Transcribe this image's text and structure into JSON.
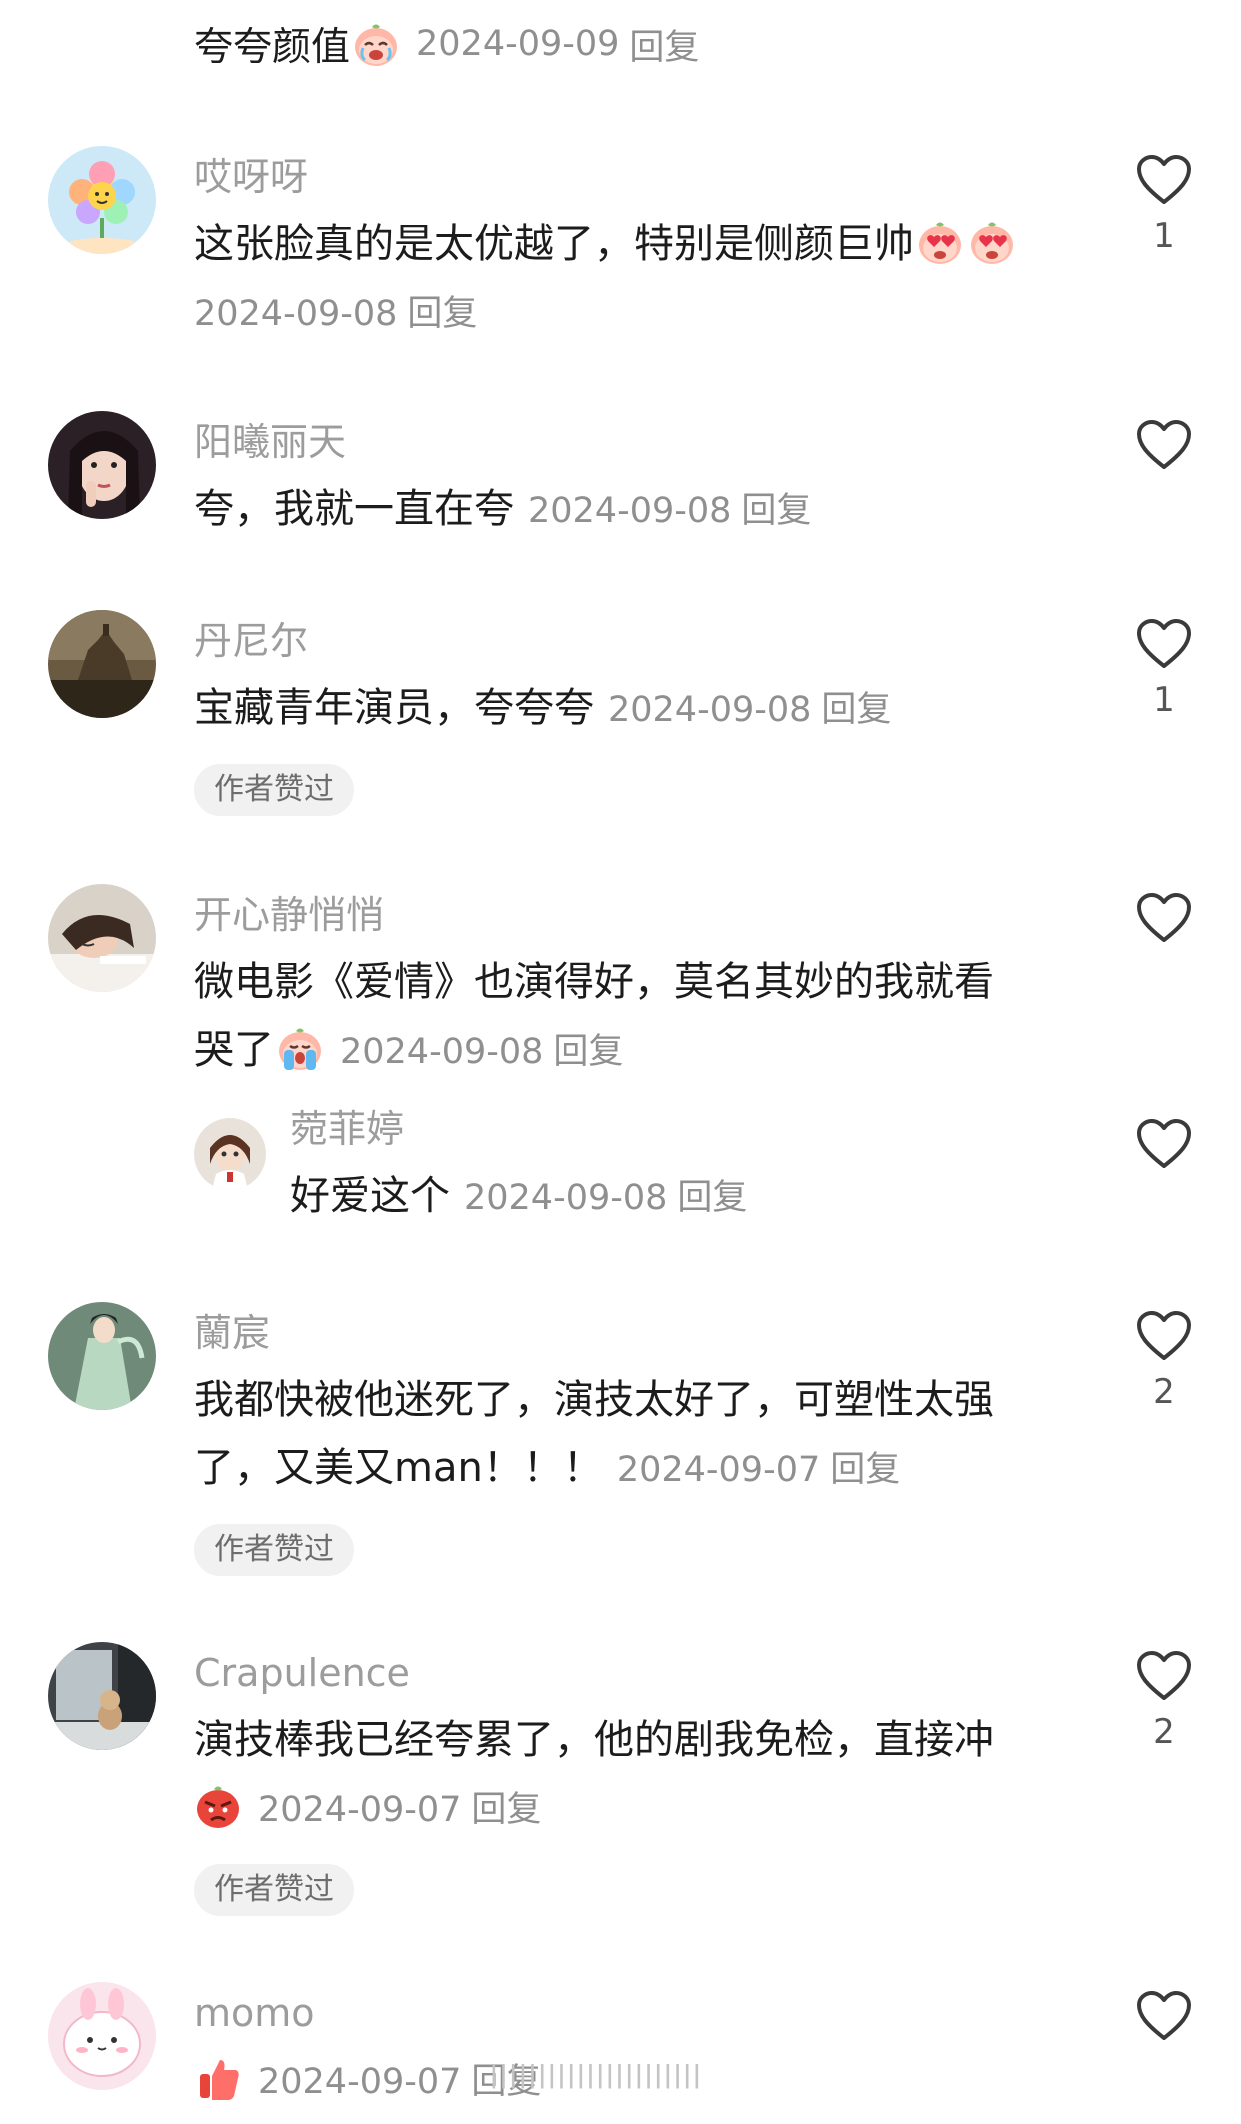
{
  "top_reply": {
    "text": "夸夸颜值",
    "emoji": "crying-laughing-emoji",
    "date": "2024-09-09",
    "reply_label": "回复"
  },
  "comments": [
    {
      "username": "哎呀呀",
      "avatar": "flower-cartoon-avatar",
      "text": "这张脸真的是太优越了，特别是侧颜巨帅",
      "emojis": [
        "heart-eyes-emoji",
        "heart-eyes-emoji"
      ],
      "date": "2024-09-08",
      "reply_label": "回复",
      "likes": "1"
    },
    {
      "username": "阳曦丽天",
      "avatar": "girl-portrait-avatar",
      "text": "夸，我就一直在夸",
      "date": "2024-09-08",
      "reply_label": "回复",
      "likes": ""
    },
    {
      "username": "丹尼尔",
      "avatar": "castle-landscape-avatar",
      "text": "宝藏青年演员，夸夸夸",
      "date": "2024-09-08",
      "reply_label": "回复",
      "likes": "1",
      "badge": "作者赞过"
    },
    {
      "username": "开心静悄悄",
      "avatar": "girl-sleeping-avatar",
      "text_line1": "微电影《爱情》也演得好，莫名其妙的我就看",
      "text_line2": "哭了",
      "emoji": "crying-emoji",
      "date": "2024-09-08",
      "reply_label": "回复",
      "likes": "",
      "sub_reply": {
        "username": "菀菲婷",
        "avatar": "anime-girl-avatar",
        "text": "好爱这个",
        "date": "2024-09-08",
        "reply_label": "回复"
      }
    },
    {
      "username": "蘭宸",
      "avatar": "ancient-costume-avatar",
      "text_line1": "我都快被他迷死了，演技太好了，可塑性太强",
      "text_line2": "了，又美又man！！！",
      "date": "2024-09-07",
      "reply_label": "回复",
      "likes": "2",
      "badge": "作者赞过"
    },
    {
      "username": "Crapulence",
      "avatar": "room-cat-avatar",
      "text_line1": "演技棒我已经夸累了，他的剧我免检，直接冲",
      "emoji": "angry-emoji",
      "date": "2024-09-07",
      "reply_label": "回复",
      "likes": "2",
      "badge": "作者赞过"
    },
    {
      "username": "momo",
      "avatar": "pink-bunny-avatar",
      "emoji": "thumbs-up-emoji",
      "date": "2024-09-07",
      "reply_label": "回复",
      "likes": ""
    }
  ],
  "watermark": "ǀǀǀǀǀǀǀǀǀǀǀǀǀǀǀǀǀǀǀǀǀǀ",
  "colors": {
    "username": "#9c9c9c",
    "meta": "#8f8f8f",
    "badge_bg": "#f1f1f1",
    "heart_outline": "#3a3a3a"
  }
}
